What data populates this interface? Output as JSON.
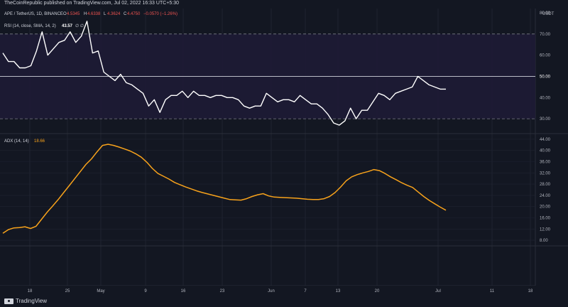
{
  "header": {
    "publish_line": "TheCoinRepublic published on TradingView.com, Jul 02, 2022 16:33 UTC+5:30"
  },
  "legend": {
    "symbol": "APE / TetherUS, 1D, BINANCE",
    "o_label": "O",
    "o_value": "4.5345",
    "h_label": "H",
    "h_value": "4.6338",
    "l_label": "L",
    "l_value": "4.3624",
    "c_label": "C",
    "c_value": "4.4750",
    "change": "−0.0570 (−1.26%)",
    "currency": "USDT"
  },
  "rsi": {
    "label": "RSI (14, close, SMA, 14, 2)",
    "value": "43.57",
    "extra": "∅ ∅",
    "last_label": "50.00"
  },
  "adx": {
    "label": "ADX (14, 14)",
    "value": "18.66"
  },
  "footer": {
    "brand": "TradingView"
  },
  "colors": {
    "background": "#131722",
    "rsi_line": "#ffffff",
    "rsi_band": "#1e1b35",
    "adx_line": "#f7a21b",
    "adx_value": "#f7a21b",
    "up": "#26a69a",
    "down": "#ef5350",
    "grid": "#1f2330"
  },
  "chart_data": [
    {
      "type": "line",
      "title": "RSI (14, close, SMA, 14, 2)",
      "ylim": [
        23,
        82
      ],
      "y_ticks": [
        "80.00",
        "70.00",
        "60.00",
        "50.00",
        "40.00",
        "30.00"
      ],
      "bands": {
        "upper": 70,
        "middle": 50,
        "lower": 30
      },
      "x_tick_labels": [
        "18",
        "25",
        "May",
        "9",
        "16",
        "23",
        "Jun",
        "7",
        "13",
        "20",
        "Jul",
        "11",
        "18"
      ],
      "series": [
        {
          "values": [
            61,
            57,
            57,
            54,
            54,
            55,
            62,
            71,
            60,
            63,
            66,
            67,
            71,
            66,
            69,
            76,
            61,
            62,
            52,
            50,
            48,
            51,
            47,
            46,
            44,
            42,
            36,
            39,
            33,
            39,
            41,
            41,
            43,
            40,
            43,
            41,
            41,
            40,
            41,
            41,
            40,
            40,
            39,
            36,
            35,
            36,
            36,
            42,
            40,
            38,
            39,
            39,
            38,
            41,
            39,
            37,
            37,
            35,
            32,
            28,
            27,
            29,
            35,
            30,
            34,
            34,
            38,
            42,
            41,
            39,
            42,
            43,
            44,
            45,
            50,
            48,
            46,
            45,
            44,
            44
          ]
        }
      ]
    },
    {
      "type": "line",
      "title": "ADX (14, 14)",
      "ylim": [
        6,
        46
      ],
      "y_ticks": [
        "44.00",
        "40.00",
        "36.00",
        "32.00",
        "28.00",
        "24.00",
        "20.00",
        "16.00",
        "12.00",
        "8.00"
      ],
      "series": [
        {
          "values": [
            10.5,
            11.8,
            12.4,
            12.5,
            12.8,
            12.2,
            13.0,
            15.5,
            18.0,
            20.2,
            22.5,
            25.0,
            27.5,
            30.0,
            32.5,
            35.0,
            37.0,
            39.5,
            41.8,
            42.2,
            41.8,
            41.2,
            40.5,
            39.8,
            38.8,
            37.6,
            35.8,
            33.6,
            31.8,
            30.8,
            29.8,
            28.6,
            27.8,
            27.0,
            26.3,
            25.6,
            25.0,
            24.5,
            24.0,
            23.5,
            23.0,
            22.5,
            22.4,
            22.3,
            22.8,
            23.6,
            24.2,
            24.6,
            23.8,
            23.4,
            23.3,
            23.2,
            23.1,
            23.0,
            22.8,
            22.6,
            22.5,
            22.5,
            22.8,
            23.6,
            25.0,
            27.0,
            29.2,
            30.6,
            31.4,
            32.0,
            32.5,
            33.2,
            32.8,
            31.8,
            30.6,
            29.6,
            28.5,
            27.6,
            26.8,
            25.2,
            23.6,
            22.2,
            21.0,
            19.8,
            18.7
          ]
        }
      ]
    }
  ]
}
